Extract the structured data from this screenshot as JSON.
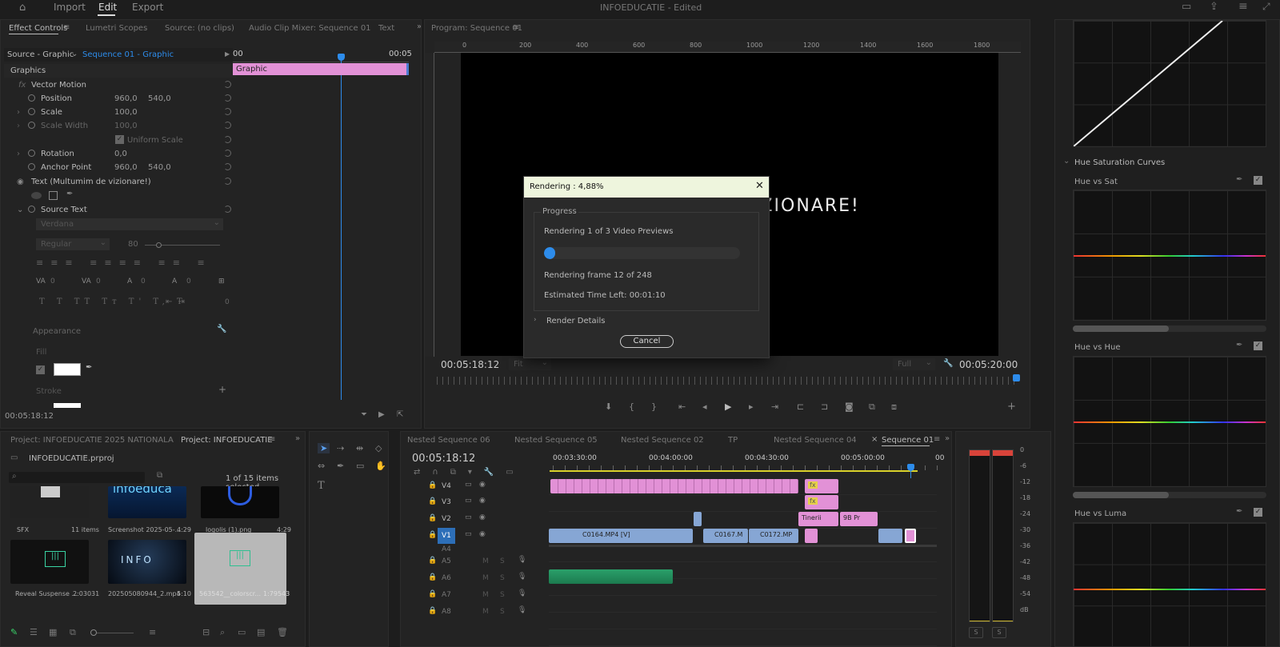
{
  "window": {
    "title": "INFOEDUCATIE - Edited"
  },
  "menu": {
    "import": "Import",
    "edit": "Edit",
    "export": "Export"
  },
  "effect_panel": {
    "tabs": [
      "Effect Controls",
      "Lumetri Scopes",
      "Source: (no clips)",
      "Audio Clip Mixer: Sequence 01",
      "Text"
    ],
    "source_label": "Source - Graphic",
    "sequence_label": "Sequence 01 - Graphic",
    "section": "Graphics",
    "vector_motion": "Vector Motion",
    "params": [
      {
        "name": "Position",
        "v1": "960,0",
        "v2": "540,0"
      },
      {
        "name": "Scale",
        "v1": "100,0",
        "v2": ""
      },
      {
        "name": "Scale Width",
        "v1": "100,0",
        "v2": ""
      },
      {
        "name": "Uniform Scale",
        "v1": "",
        "v2": ""
      },
      {
        "name": "Rotation",
        "v1": "0,0",
        "v2": ""
      },
      {
        "name": "Anchor Point",
        "v1": "960,0",
        "v2": "540,0"
      }
    ],
    "text_layer": "Text (Multumim de vizionare!)",
    "source_text": "Source Text",
    "font": "Verdana",
    "style": "Regular",
    "size": "80",
    "tracking": [
      "0",
      "0",
      "0",
      "0",
      "0"
    ],
    "appearance": "Appearance",
    "fill": "Fill",
    "stroke": "Stroke",
    "timecode": "00:05:18:12",
    "mini_tl_start": "00",
    "mini_tl_end": "00:05",
    "clip_label": "Graphic"
  },
  "program": {
    "tab": "Program: Sequence 01",
    "ruler": [
      "0",
      "200",
      "400",
      "600",
      "800",
      "1000",
      "1200",
      "1400",
      "1600",
      "1800"
    ],
    "overlay_text": "IZIONARE!",
    "timecode_left": "00:05:18:12",
    "fit": "Fit",
    "full": "Full",
    "timecode_right": "00:05:20:00"
  },
  "dialog": {
    "title": "Rendering : 4,88%",
    "group": "Progress",
    "line1": "Rendering 1 of 3 Video Previews",
    "progress": 0.0488,
    "line2": "Rendering frame 12 of 248",
    "line3": "Estimated Time Left: 00:01:10",
    "details": "Render Details",
    "cancel": "Cancel"
  },
  "project": {
    "tabs": [
      "Project: INFOEDUCATIE 2025 NATIONALA",
      "Project: INFOEDUCATIE"
    ],
    "file": "INFOEDUCATIE.prproj",
    "selection": "1 of 15 items selected",
    "items": [
      {
        "name": "SFX",
        "meta": "11 items"
      },
      {
        "name": "Screenshot 2025-05-...",
        "meta": "4:29"
      },
      {
        "name": "logolis (1).png",
        "meta": "4:29"
      },
      {
        "name": "Reveal Suspense ...",
        "meta": "2:03031"
      },
      {
        "name": "202505080944_2.mp4",
        "meta": "5:10"
      },
      {
        "name": "563542__colorscr...",
        "meta": "1:79543"
      }
    ]
  },
  "timeline": {
    "tabs": [
      "Nested Sequence 06",
      "Nested Sequence 05",
      "Nested Sequence 02",
      "TP",
      "Nested Sequence 04",
      "Sequence 01"
    ],
    "timecode": "00:05:18:12",
    "ruler": [
      "00:03:30:00",
      "00:04:00:00",
      "00:04:30:00",
      "00:05:00:00",
      "00"
    ],
    "video_tracks": [
      "V4",
      "V3",
      "V2",
      "V1"
    ],
    "audio_tracks": [
      "A4",
      "A5",
      "A6",
      "A7",
      "A8"
    ],
    "clips": {
      "c1": "C0164.MP4 [V]",
      "c2": "C0167.M",
      "c3": "C0172.MP",
      "c4": "Tinerii",
      "c5": "9B Pr"
    },
    "m": "M",
    "s": "S"
  },
  "meter": {
    "scale": [
      "0",
      "-6",
      "-12",
      "-18",
      "-24",
      "-30",
      "-36",
      "-42",
      "-48",
      "-54",
      "dB"
    ],
    "s": "S"
  },
  "lumetri": {
    "section": "Hue Saturation Curves",
    "curves": [
      "Hue vs Sat",
      "Hue vs Hue",
      "Hue vs Luma"
    ]
  }
}
